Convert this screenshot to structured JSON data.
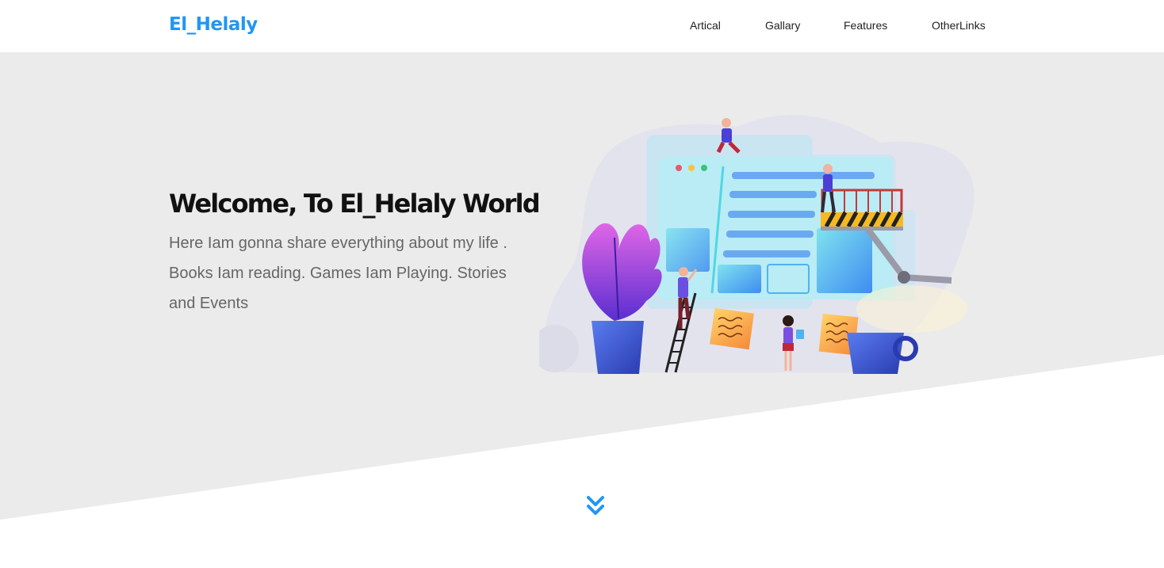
{
  "header": {
    "logo": "El_Helaly",
    "nav": [
      {
        "label": "Artical"
      },
      {
        "label": "Gallary"
      },
      {
        "label": "Features"
      },
      {
        "label": "OtherLinks"
      }
    ]
  },
  "hero": {
    "title": "Welcome, To El_Helaly World",
    "description": "Here Iam gonna share everything about my life . Books Iam reading. Games Iam Playing. Stories and Events"
  },
  "colors": {
    "accent": "#2196f3",
    "hero_background": "#ebebeb",
    "text_dark": "#111111",
    "text_muted": "#666666"
  },
  "icons": {
    "scroll": "double-chevron-down-icon"
  }
}
